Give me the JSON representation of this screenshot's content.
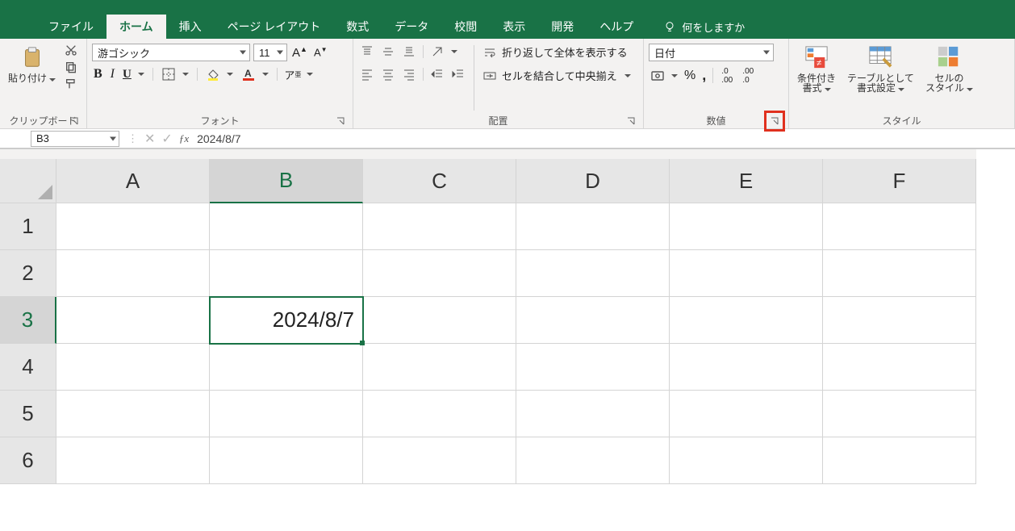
{
  "menu": {
    "file": "ファイル",
    "home": "ホーム",
    "insert": "挿入",
    "layout": "ページ レイアウト",
    "formulas": "数式",
    "data": "データ",
    "review": "校閲",
    "view": "表示",
    "dev": "開発",
    "help": "ヘルプ",
    "tellme": "何をしますか"
  },
  "ribbon": {
    "clipboard": {
      "label": "クリップボード",
      "paste": "貼り付け"
    },
    "font": {
      "label": "フォント",
      "name": "游ゴシック",
      "size": "11",
      "bold": "B",
      "italic": "I",
      "underline": "U"
    },
    "align": {
      "label": "配置",
      "wrap": "折り返して全体を表示する",
      "merge": "セルを結合して中央揃え"
    },
    "number": {
      "label": "数値",
      "format": "日付",
      "percent": "%",
      "comma": ","
    },
    "styles": {
      "label": "スタイル",
      "cond": "条件付き\n書式",
      "table": "テーブルとして\n書式設定",
      "cell": "セルの\nスタイル"
    }
  },
  "formula_bar": {
    "namebox": "B3",
    "value": "2024/8/7"
  },
  "sheet": {
    "columns": [
      "A",
      "B",
      "C",
      "D",
      "E",
      "F"
    ],
    "rows": [
      "1",
      "2",
      "3",
      "4",
      "5",
      "6"
    ],
    "selected_col": "B",
    "selected_row": "3",
    "cells": {
      "B3": "2024/8/7"
    }
  }
}
